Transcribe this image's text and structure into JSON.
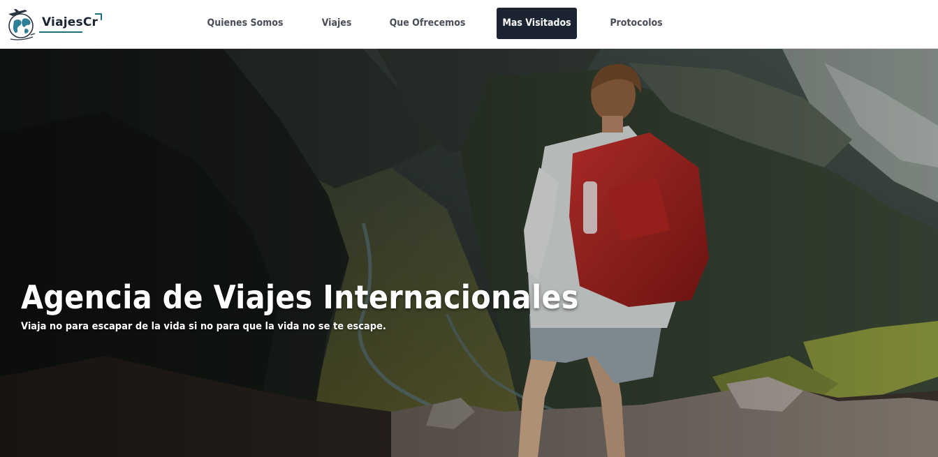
{
  "brand": {
    "name": "ViajesCr",
    "logo_icon": "globe-airplane-icon",
    "accent_color": "#1f6f83"
  },
  "nav": {
    "items": [
      {
        "label": "Quienes Somos",
        "active": false
      },
      {
        "label": "Viajes",
        "active": false
      },
      {
        "label": "Que Ofrecemos",
        "active": false
      },
      {
        "label": "Mas Visitados",
        "active": true
      },
      {
        "label": "Protocolos",
        "active": false
      }
    ],
    "active_bg_color": "#1b2430"
  },
  "hero": {
    "title": "Agencia de Viajes Internacionales",
    "subtitle": "Viaja no para escapar de la vida si no para que la vida no se te escape.",
    "background_image": "hiker-with-red-backpack-overlooking-mountain-valley"
  }
}
